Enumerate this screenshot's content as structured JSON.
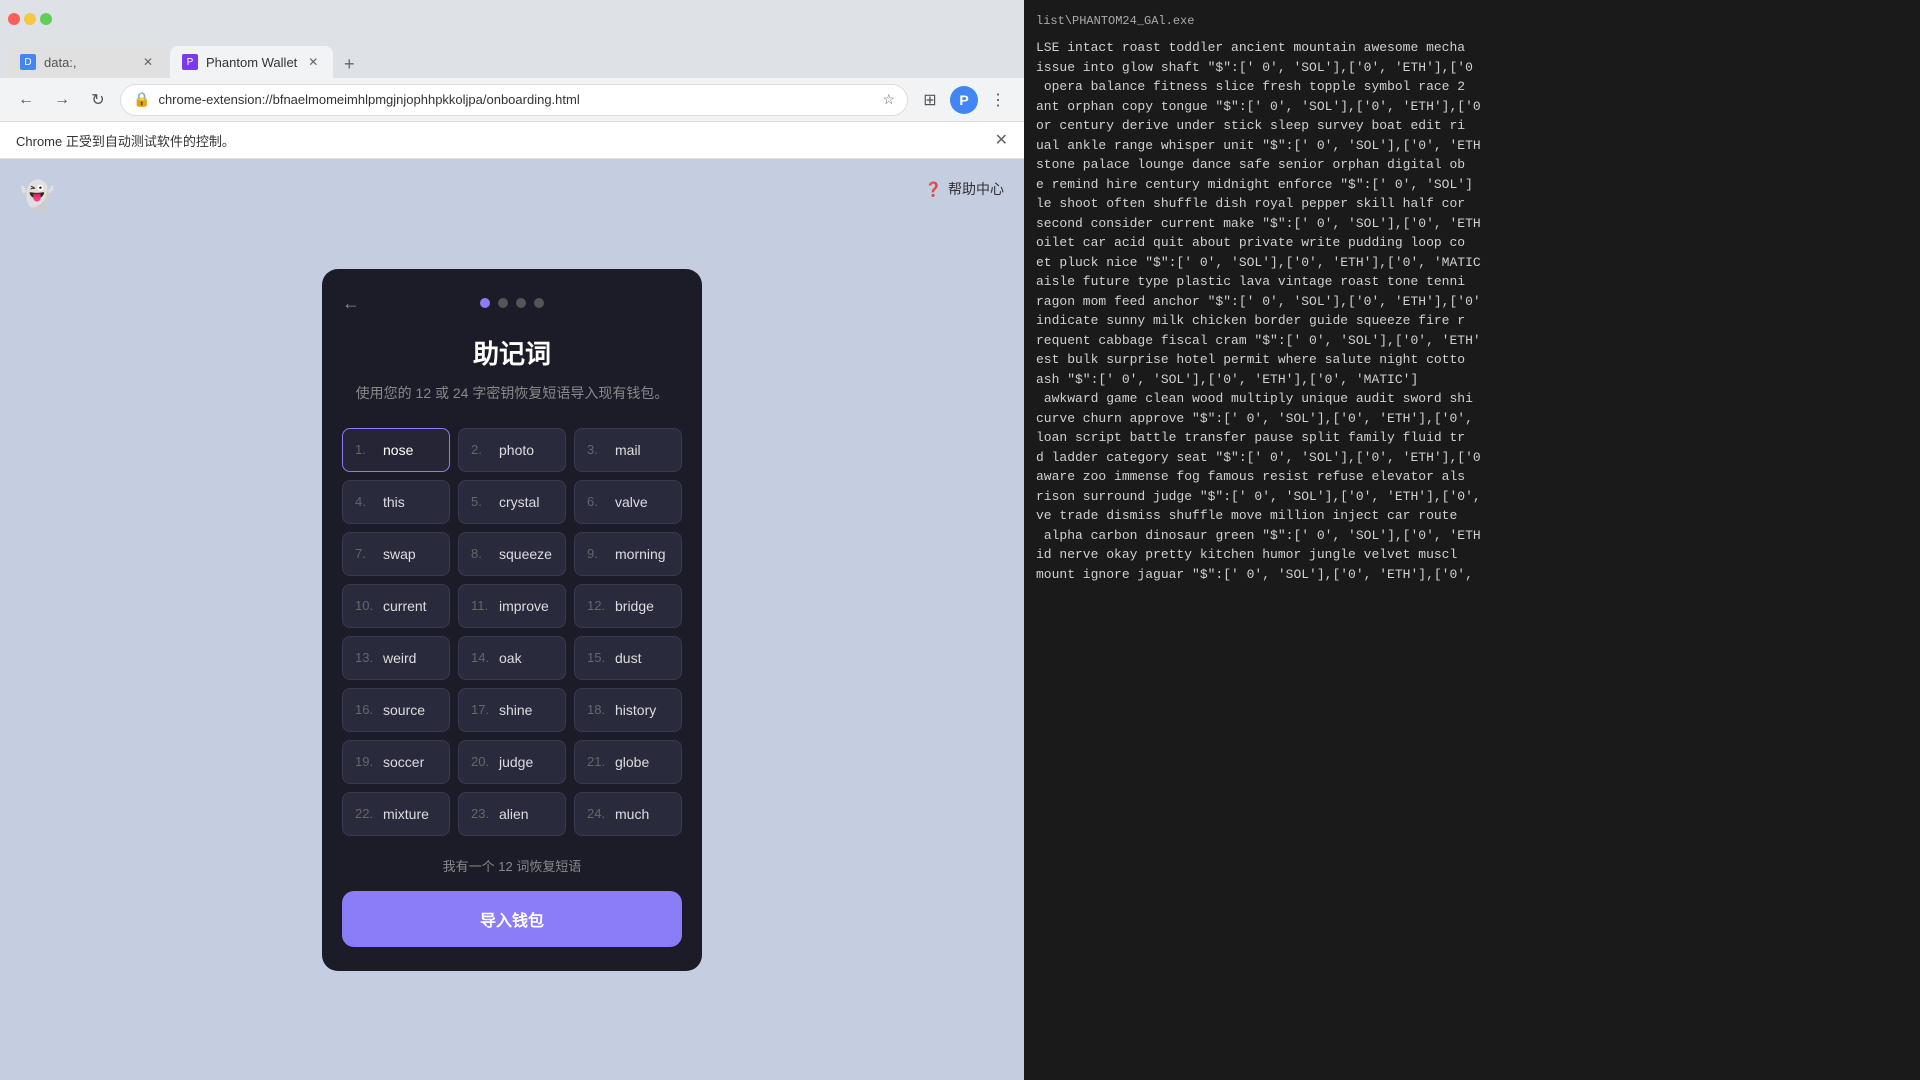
{
  "browser": {
    "tabs": [
      {
        "id": "tab1",
        "label": "data:,",
        "favicon": "D",
        "active": false
      },
      {
        "id": "tab2",
        "label": "Phantom Wallet",
        "favicon": "P",
        "active": true
      }
    ],
    "url": "chrome-extension://bfnaelmomeimhlpmgjnjophhpkkoljpa/onboarding.html",
    "notification": "Chrome 正受到自动测试软件的控制。"
  },
  "page": {
    "help_center": "帮助中心",
    "modal": {
      "title": "助记词",
      "subtitle": "使用您的 12 或 24 字密钥恢复短语导入现有钱包。",
      "progress_dots": 4,
      "active_dot": 0,
      "seeds": [
        {
          "num": "1.",
          "word": "nose",
          "active": true
        },
        {
          "num": "2.",
          "word": "photo",
          "active": false
        },
        {
          "num": "3.",
          "word": "mail",
          "active": false
        },
        {
          "num": "4.",
          "word": "this",
          "active": false
        },
        {
          "num": "5.",
          "word": "crystal",
          "active": false
        },
        {
          "num": "6.",
          "word": "valve",
          "active": false
        },
        {
          "num": "7.",
          "word": "swap",
          "active": false
        },
        {
          "num": "8.",
          "word": "squeeze",
          "active": false
        },
        {
          "num": "9.",
          "word": "morning",
          "active": false
        },
        {
          "num": "10.",
          "word": "current",
          "active": false
        },
        {
          "num": "11.",
          "word": "improve",
          "active": false
        },
        {
          "num": "12.",
          "word": "bridge",
          "active": false
        },
        {
          "num": "13.",
          "word": "weird",
          "active": false
        },
        {
          "num": "14.",
          "word": "oak",
          "active": false
        },
        {
          "num": "15.",
          "word": "dust",
          "active": false
        },
        {
          "num": "16.",
          "word": "source",
          "active": false
        },
        {
          "num": "17.",
          "word": "shine",
          "active": false
        },
        {
          "num": "18.",
          "word": "history",
          "active": false
        },
        {
          "num": "19.",
          "word": "soccer",
          "active": false
        },
        {
          "num": "20.",
          "word": "judge",
          "active": false
        },
        {
          "num": "21.",
          "word": "globe",
          "active": false
        },
        {
          "num": "22.",
          "word": "mixture",
          "active": false
        },
        {
          "num": "23.",
          "word": "alien",
          "active": false
        },
        {
          "num": "24.",
          "word": "much",
          "active": false
        }
      ],
      "switch_label": "我有一个 12 词恢复短语",
      "import_button": "导入钱包"
    }
  },
  "terminal": {
    "title": "list\\PHANTOM24_GAl.exe",
    "lines": [
      "LSE intact roast toddler ancient mountain awesome mecha",
      "issue into glow shaft \"$\":[' 0', 'SOL'],['0', 'ETH'],['0",
      " opera balance fitness slice fresh topple symbol race 2",
      "ant orphan copy tongue \"$\":[' 0', 'SOL'],['0', 'ETH'],['0",
      "or century derive under stick sleep survey boat edit ri",
      "ual ankle range whisper unit \"$\":[' 0', 'SOL'],['0', 'ETH",
      "stone palace lounge dance safe senior orphan digital ob",
      "e remind hire century midnight enforce \"$\":[' 0', 'SOL']",
      "le shoot often shuffle dish royal pepper skill half cor",
      "second consider current make \"$\":[' 0', 'SOL'],['0', 'ETH",
      "oilet car acid quit about private write pudding loop co",
      "et pluck nice \"$\":[' 0', 'SOL'],['0', 'ETH'],['0', 'MATIC",
      "aisle future type plastic lava vintage roast tone tenni",
      "ragon mom feed anchor \"$\":[' 0', 'SOL'],['0', 'ETH'],['0'",
      "indicate sunny milk chicken border guide squeeze fire r",
      "requent cabbage fiscal cram \"$\":[' 0', 'SOL'],['0', 'ETH'",
      "est bulk surprise hotel permit where salute night cotto",
      "ash \"$\":[' 0', 'SOL'],['0', 'ETH'],['0', 'MATIC']",
      " awkward game clean wood multiply unique audit sword shi",
      "curve churn approve \"$\":[' 0', 'SOL'],['0', 'ETH'],['0', ",
      "loan script battle transfer pause split family fluid tr",
      "d ladder category seat \"$\":[' 0', 'SOL'],['0', 'ETH'],['0",
      "aware zoo immense fog famous resist refuse elevator als",
      "rison surround judge \"$\":[' 0', 'SOL'],['0', 'ETH'],['0',",
      "ve trade dismiss shuffle move million inject car route ",
      " alpha carbon dinosaur green \"$\":[' 0', 'SOL'],['0', 'ETH",
      "id nerve okay pretty kitchen humor jungle velvet muscl",
      "mount ignore jaguar \"$\":[' 0', 'SOL'],['0', 'ETH'],['0', "
    ]
  }
}
